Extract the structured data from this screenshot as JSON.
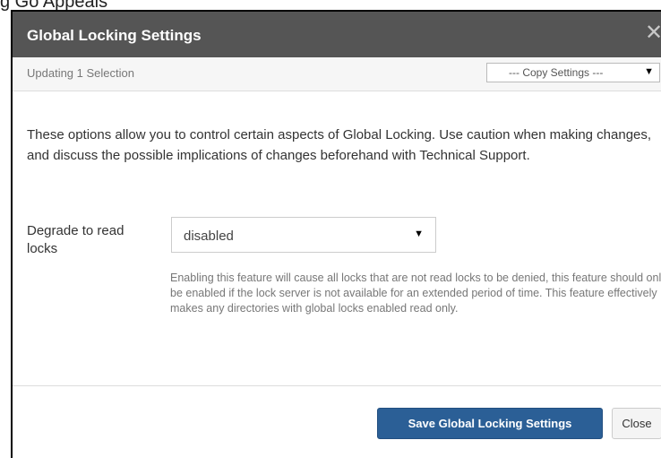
{
  "background": {
    "partial_text": "g Go Appeals"
  },
  "dialog": {
    "title": "Global Locking Settings",
    "close_icon": "close-icon",
    "subtitle": "Updating 1 Selection",
    "copy_settings": {
      "selected": "--- Copy Settings ---"
    },
    "description": "These options allow you to control certain aspects of Global Locking. Use caution when making changes, and discuss the possible implications of changes beforehand with Technical Support.",
    "fields": [
      {
        "label": "Degrade to read locks",
        "selected": "disabled",
        "help": "Enabling this feature will cause all locks that are not read locks to be denied, this feature should only be enabled if the lock server is not available for an extended period of time. This feature effectively makes any directories with global locks enabled read only."
      }
    ],
    "footer": {
      "save_label": "Save Global Locking Settings",
      "close_label": "Close"
    }
  },
  "colors": {
    "header_bg": "#555555",
    "primary_button": "#2b5f96"
  }
}
